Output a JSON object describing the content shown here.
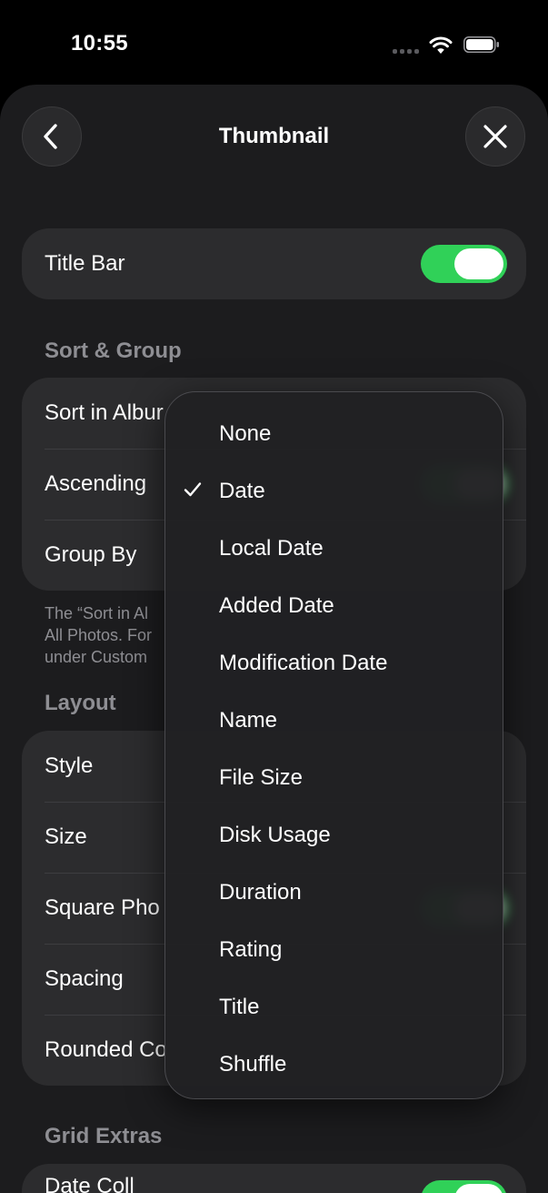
{
  "status_bar": {
    "time": "10:55"
  },
  "header": {
    "title": "Thumbnail"
  },
  "title_bar_row": {
    "label": "Title Bar",
    "enabled": true
  },
  "sort_group": {
    "heading": "Sort & Group",
    "rows": [
      "Sort in Albur",
      "Ascending",
      "Group By"
    ],
    "footnote": [
      "The “Sort in Al",
      "All Photos. For",
      "under Custom"
    ]
  },
  "layout": {
    "heading": "Layout",
    "rows": [
      "Style",
      "Size",
      "Square Pho",
      "Spacing",
      "Rounded Co"
    ]
  },
  "grid_extras": {
    "heading": "Grid Extras",
    "first_row": "Date Coll"
  },
  "sort_menu": {
    "selected": "Date",
    "options": [
      "None",
      "Date",
      "Local Date",
      "Added Date",
      "Modification Date",
      "Name",
      "File Size",
      "Disk Usage",
      "Duration",
      "Rating",
      "Title",
      "Shuffle"
    ]
  },
  "colors": {
    "accent_green": "#30d158",
    "background": "#1c1c1e",
    "card": "#2c2c2e"
  }
}
